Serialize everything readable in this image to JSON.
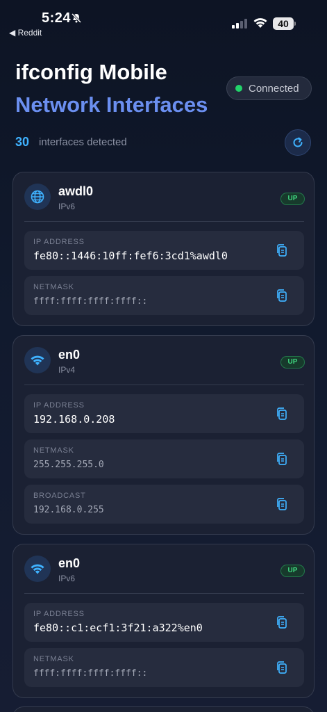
{
  "status_bar": {
    "time": "5:24",
    "back_label": "◀ Reddit",
    "battery": "40"
  },
  "header": {
    "title": "ifconfig Mobile",
    "subtitle": "Network Interfaces",
    "connection_status": "Connected",
    "interface_count": "30",
    "interface_count_label": "interfaces detected"
  },
  "colors": {
    "accent": "#3fb2ff",
    "subtitle": "#6b8ff0",
    "status_up": "#3fd67f",
    "connected_dot": "#22d36a"
  },
  "interfaces": [
    {
      "name": "awdl0",
      "family": "IPv6",
      "status": "UP",
      "icon": "globe-icon",
      "fields": [
        {
          "label": "IP ADDRESS",
          "value": "fe80::1446:10ff:fef6:3cd1%awdl0"
        },
        {
          "label": "NETMASK",
          "value": "ffff:ffff:ffff:ffff::"
        }
      ]
    },
    {
      "name": "en0",
      "family": "IPv4",
      "status": "UP",
      "icon": "wifi-icon",
      "fields": [
        {
          "label": "IP ADDRESS",
          "value": "192.168.0.208"
        },
        {
          "label": "NETMASK",
          "value": "255.255.255.0"
        },
        {
          "label": "BROADCAST",
          "value": "192.168.0.255"
        }
      ]
    },
    {
      "name": "en0",
      "family": "IPv6",
      "status": "UP",
      "icon": "wifi-icon",
      "fields": [
        {
          "label": "IP ADDRESS",
          "value": "fe80::c1:ecf1:3f21:a322%en0"
        },
        {
          "label": "NETMASK",
          "value": "ffff:ffff:ffff:ffff::"
        }
      ]
    }
  ]
}
